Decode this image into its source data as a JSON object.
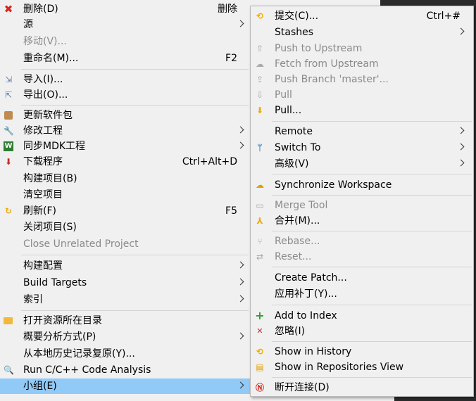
{
  "main_menu": {
    "items": [
      {
        "label": "删除(D)",
        "accel": "删除"
      },
      {
        "label": "源"
      },
      {
        "label": "移动(V)..."
      },
      {
        "label": "重命名(M)...",
        "accel": "F2"
      },
      {
        "label": "导入(I)..."
      },
      {
        "label": "导出(O)..."
      },
      {
        "label": "更新软件包"
      },
      {
        "label": "修改工程"
      },
      {
        "label": "同步MDK工程"
      },
      {
        "label": "下载程序",
        "accel": "Ctrl+Alt+D"
      },
      {
        "label": "构建项目(B)"
      },
      {
        "label": "清空项目"
      },
      {
        "label": "刷新(F)",
        "accel": "F5"
      },
      {
        "label": "关闭项目(S)"
      },
      {
        "label": "Close Unrelated Project"
      },
      {
        "label": "构建配置"
      },
      {
        "label": "Build Targets"
      },
      {
        "label": "索引"
      },
      {
        "label": "打开资源所在目录"
      },
      {
        "label": "概要分析方式(P)"
      },
      {
        "label": "从本地历史记录复原(Y)..."
      },
      {
        "label": "Run C/C++ Code Analysis"
      },
      {
        "label": "小组(E)"
      }
    ]
  },
  "sub_menu": {
    "items": [
      {
        "label": "提交(C)...",
        "accel": "Ctrl+#"
      },
      {
        "label": "Stashes"
      },
      {
        "label": "Push to Upstream"
      },
      {
        "label": "Fetch from Upstream"
      },
      {
        "label": "Push Branch 'master'..."
      },
      {
        "label": "Pull"
      },
      {
        "label": "Pull..."
      },
      {
        "label": "Remote"
      },
      {
        "label": "Switch To"
      },
      {
        "label": "高级(V)"
      },
      {
        "label": "Synchronize Workspace"
      },
      {
        "label": "Merge Tool"
      },
      {
        "label": "合并(M)..."
      },
      {
        "label": "Rebase..."
      },
      {
        "label": "Reset..."
      },
      {
        "label": "Create Patch..."
      },
      {
        "label": "应用补丁(Y)..."
      },
      {
        "label": "Add to Index"
      },
      {
        "label": "忽略(I)"
      },
      {
        "label": "Show in History"
      },
      {
        "label": "Show in Repositories View"
      },
      {
        "label": "断开连接(D)"
      }
    ]
  },
  "colors": {
    "highlight": "#91c9f7",
    "disabled_text": "#8a8a8a",
    "menu_bg": "#f0f0f0"
  }
}
